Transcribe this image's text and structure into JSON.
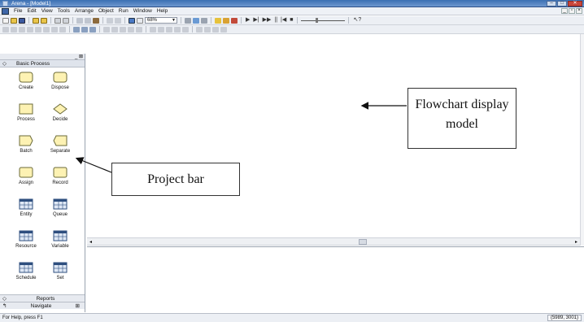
{
  "window": {
    "title": "Arena - [Model1]"
  },
  "menu": [
    "File",
    "Edit",
    "View",
    "Tools",
    "Arrange",
    "Object",
    "Run",
    "Window",
    "Help"
  ],
  "toolbar": {
    "zoom_value": "68%"
  },
  "project_bar": {
    "panel_title": "Basic Process",
    "modules": [
      {
        "label": "Create",
        "icon": "create-module-icon"
      },
      {
        "label": "Dispose",
        "icon": "dispose-module-icon"
      },
      {
        "label": "Process",
        "icon": "process-module-icon"
      },
      {
        "label": "Decide",
        "icon": "decide-module-icon"
      },
      {
        "label": "Batch",
        "icon": "batch-module-icon"
      },
      {
        "label": "Separate",
        "icon": "separate-module-icon"
      },
      {
        "label": "Assign",
        "icon": "assign-module-icon"
      },
      {
        "label": "Record",
        "icon": "record-module-icon"
      },
      {
        "label": "Entity",
        "icon": "entity-table-icon"
      },
      {
        "label": "Queue",
        "icon": "queue-table-icon"
      },
      {
        "label": "Resource",
        "icon": "resource-table-icon"
      },
      {
        "label": "Variable",
        "icon": "variable-table-icon"
      },
      {
        "label": "Schedule",
        "icon": "schedule-table-icon"
      },
      {
        "label": "Set",
        "icon": "set-table-icon"
      }
    ],
    "reports_label": "Reports",
    "navigate_label": "Navigate"
  },
  "annotations": {
    "flowchart_label": "Flowchart display model",
    "project_bar_label": "Project bar"
  },
  "status": {
    "hint": "For Help, press F1",
    "coords": "(5989, 3001)"
  },
  "colors": {
    "module_fill": "#fdf2b3",
    "module_stroke": "#6b6b3a",
    "table_header": "#2f4f7f",
    "table_fill": "#dfe8f5"
  }
}
